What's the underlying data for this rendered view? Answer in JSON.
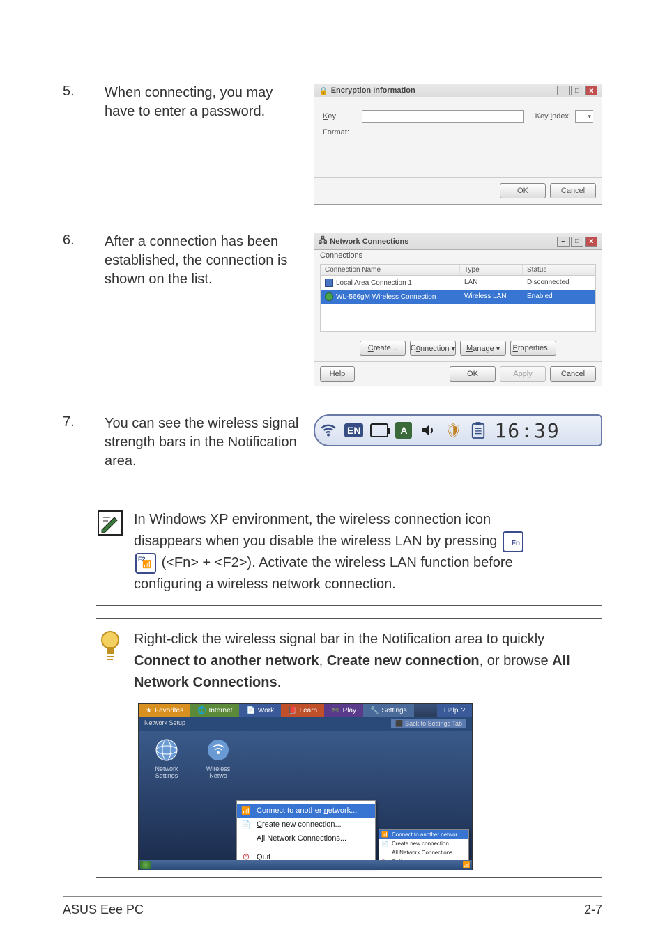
{
  "steps": {
    "s5": {
      "num": "5.",
      "text": "When connecting, you may have to enter a password."
    },
    "s6": {
      "num": "6.",
      "text": "After a connection has been established, the connection is shown on the list."
    },
    "s7": {
      "num": "7.",
      "text": "You can see the wireless signal strength bars in the Notification area."
    }
  },
  "encryption_dialog": {
    "title": "Encryption Information",
    "key_label": "Key:",
    "format_label": "Format:",
    "key_index_label": "Key index:",
    "ok": "OK",
    "cancel": "Cancel"
  },
  "network_dialog": {
    "title": "Network Connections",
    "menu": "Connections",
    "cols": {
      "name": "Connection Name",
      "type": "Type",
      "status": "Status"
    },
    "rows": [
      {
        "name": "Local Area Connection 1",
        "type": "LAN",
        "status": "Disconnected"
      },
      {
        "name": "WL-566gM Wireless Connection",
        "type": "Wireless LAN",
        "status": "Enabled"
      }
    ],
    "buttons": {
      "create": "Create...",
      "connection": "Connection ▾",
      "manage": "Manage ▾",
      "properties": "Properties..."
    },
    "help": "Help",
    "ok": "OK",
    "apply": "Apply",
    "cancel": "Cancel"
  },
  "systray": {
    "lang": "EN",
    "time": "16:39"
  },
  "note1": {
    "line1": "In Windows XP environment, the wireless connection icon",
    "line2": "disappears when you disable the wireless LAN by pressing ",
    "fn_key": "Fn",
    "f2_key": "F2",
    "line3_mid": "(<Fn> + <F2>). Activate the wireless LAN function before",
    "line4": "configuring a wireless network connection."
  },
  "note2": {
    "pre": "Right-click the wireless signal bar in the Notification area to quickly ",
    "b1": "Connect to another network",
    "sep1": ", ",
    "b2": "Create new connection",
    "sep2": ", or browse ",
    "b3": "All Network Connections",
    "end": "."
  },
  "feature": {
    "tabs": {
      "fav": "Favorites",
      "int": "Internet",
      "work": "Work",
      "learn": "Learn",
      "play": "Play",
      "set": "Settings",
      "help": "Help"
    },
    "subbar_left": "Network Setup",
    "subbar_right": "Back to Settings Tab",
    "icons": {
      "net": "Network\nSettings",
      "wlan": "Wireless\nNetwo"
    },
    "ctx": {
      "i1": "Connect to another network...",
      "i2": "Create new connection...",
      "i3": "All Network Connections...",
      "i4": "Quit"
    },
    "mini": {
      "m1": "Connect to another networ...",
      "m2": "Create new connection...",
      "m3": "All Network Connections...",
      "m4": "Quit"
    }
  },
  "footer": {
    "left": "ASUS Eee PC",
    "right": "2-7"
  }
}
